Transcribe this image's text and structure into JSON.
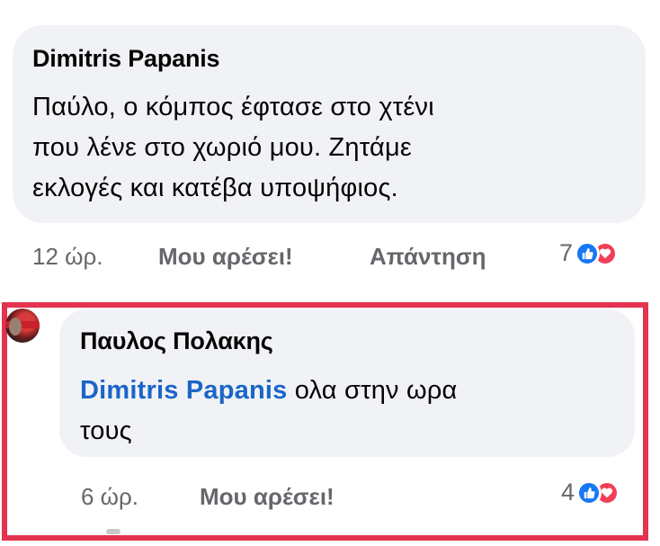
{
  "comment1": {
    "author": "Dimitris Papanis",
    "text_lines": [
      "Παύλο,  ο κόμπος έφτασε στο χτένι",
      "που λένε στο χωριό μου. Ζητάμε",
      "εκλογές και κατέβα υποψήφιος."
    ],
    "time": "12 ώρ.",
    "like_label": "Μου αρέσει!",
    "reply_label": "Απάντηση",
    "reaction_count": "7",
    "reaction_icons": [
      "like-icon",
      "love-icon"
    ]
  },
  "comment2": {
    "author": "Παυλος Πολακης",
    "mention": "Dimitris Papanis",
    "text_after_mention": " ολα στην ωρα",
    "text_line2": "τους",
    "time": "6 ώρ.",
    "like_label": "Μου αρέσει!",
    "reaction_count": "4",
    "reaction_icons": [
      "like-icon",
      "love-icon"
    ]
  },
  "colors": {
    "bubble": "#f0f2f5",
    "mention": "#1b65c9",
    "meta": "#65676b",
    "highlight_frame": "#e2334f",
    "like": "#1877f2",
    "love": "#f33e58"
  }
}
